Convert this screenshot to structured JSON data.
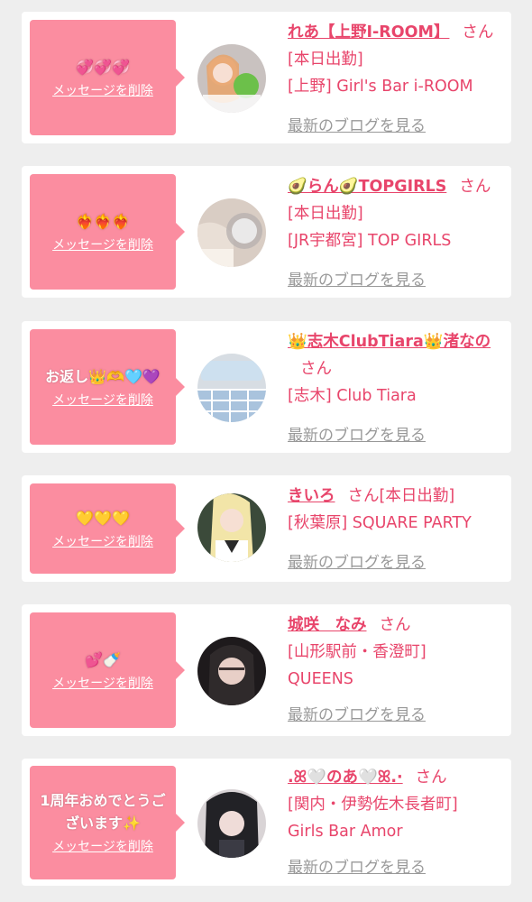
{
  "colors": {
    "accent": "#e8456b",
    "bubble": "#fb8da0",
    "muted": "#999999",
    "background": "#eeeeee"
  },
  "common": {
    "delete_label": "メッセージを削除",
    "blog_label": "最新のブログを見る",
    "honorific": "さん"
  },
  "cards": [
    {
      "message": "💞💞💞",
      "name": "れあ【上野I-ROOM】",
      "status": "[本日出勤]",
      "shop": "[上野] Girl's Bar i-ROOM"
    },
    {
      "message": "❤️‍🔥❤️‍🔥❤️‍🔥",
      "name": "🥑らん🥑TOPGIRLS",
      "status": "[本日出勤]",
      "shop": "[JR宇都宮] TOP GIRLS"
    },
    {
      "message": "お返し👑🫶🩵💜",
      "name": "👑志木ClubTiara👑渚なの",
      "status": "",
      "shop": "[志木] Club Tiara"
    },
    {
      "message": "💛💛💛",
      "name": "きいろ",
      "status": "[本日出勤]",
      "shop": "[秋葉原] SQUARE PARTY"
    },
    {
      "message": "💕🍼",
      "name": "城咲　なみ",
      "status": "",
      "shop": "[山形駅前・香澄町] QUEENS"
    },
    {
      "message": "1周年おめでとうございます✨",
      "name": ".ꕤ🤍のあ🤍ꕤ.·",
      "status": "",
      "shop": "[関内・伊勢佐木長者町] Girls Bar Amor"
    }
  ]
}
